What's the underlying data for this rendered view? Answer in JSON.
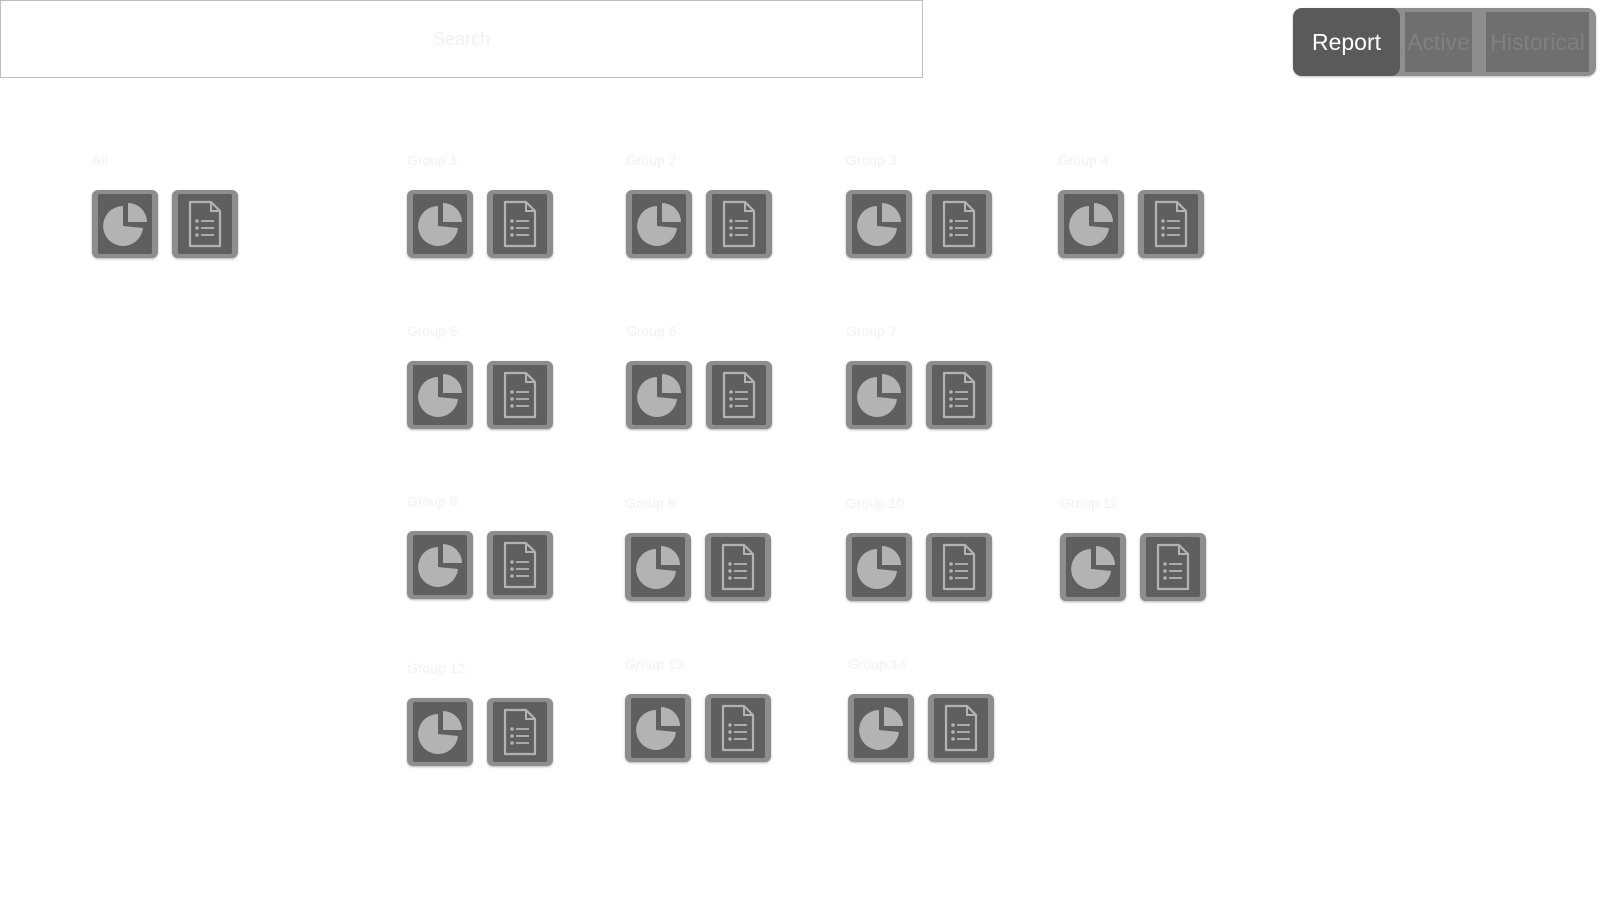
{
  "search": {
    "placeholder": "Search"
  },
  "tabs": [
    {
      "label": "Report",
      "selected": true
    },
    {
      "label": "Active",
      "selected": false
    },
    {
      "label": "Historical",
      "selected": false
    }
  ],
  "colors": {
    "selected_tab_bg": "#5a5a5a",
    "tab_bg": "#6f6f6f",
    "icon_frame": "#8d8d8d",
    "icon_inner": "#5f5f5f",
    "icon_glyph": "#b3b3b3"
  },
  "groups": [
    {
      "label": "All",
      "icons": [
        "pie-chart-icon",
        "document-list-icon"
      ]
    },
    {
      "label": "Group 1",
      "icons": [
        "pie-chart-icon",
        "document-list-icon"
      ]
    },
    {
      "label": "Group 2",
      "icons": [
        "pie-chart-icon",
        "document-list-icon"
      ]
    },
    {
      "label": "Group 3",
      "icons": [
        "pie-chart-icon",
        "document-list-icon"
      ]
    },
    {
      "label": "Group 4",
      "icons": [
        "pie-chart-icon",
        "document-list-icon"
      ]
    },
    {
      "label": "Group 5",
      "icons": [
        "pie-chart-icon",
        "document-list-icon"
      ]
    },
    {
      "label": "Group 6",
      "icons": [
        "pie-chart-icon",
        "document-list-icon"
      ]
    },
    {
      "label": "Group 7",
      "icons": [
        "pie-chart-icon",
        "document-list-icon"
      ]
    },
    {
      "label": "Group 8",
      "icons": [
        "pie-chart-icon",
        "document-list-icon"
      ]
    },
    {
      "label": "Group 9",
      "icons": [
        "pie-chart-icon",
        "document-list-icon"
      ]
    },
    {
      "label": "Group 10",
      "icons": [
        "pie-chart-icon",
        "document-list-icon"
      ]
    },
    {
      "label": "Group 11",
      "icons": [
        "pie-chart-icon",
        "document-list-icon"
      ]
    },
    {
      "label": "Group 12",
      "icons": [
        "pie-chart-icon",
        "document-list-icon"
      ]
    },
    {
      "label": "Group 13",
      "icons": [
        "pie-chart-icon",
        "document-list-icon"
      ]
    },
    {
      "label": "Group 14",
      "icons": [
        "pie-chart-icon",
        "document-list-icon"
      ]
    }
  ]
}
